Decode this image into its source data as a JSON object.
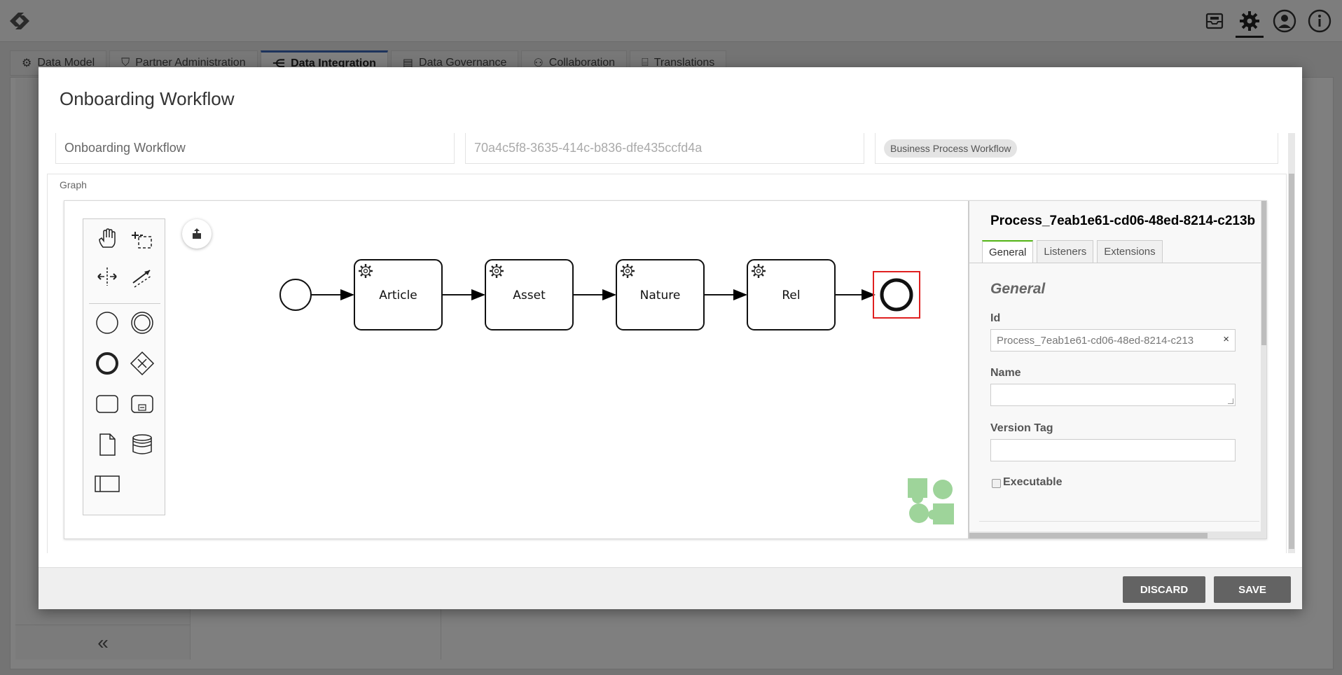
{
  "app": {
    "tabs": [
      {
        "label": "Data Model",
        "icon": "data-model-icon"
      },
      {
        "label": "Partner Administration",
        "icon": "shield-icon"
      },
      {
        "label": "Data Integration",
        "icon": "share-icon"
      },
      {
        "label": "Data Governance",
        "icon": "document-icon"
      },
      {
        "label": "Collaboration",
        "icon": "people-icon"
      },
      {
        "label": "Translations",
        "icon": "translate-icon"
      }
    ],
    "collapse_symbol": "«"
  },
  "modal": {
    "title": "Onboarding Workflow",
    "fields": {
      "name_value": "Onboarding Workflow",
      "id_value": "70a4c5f8-3635-414c-b836-dfe435ccfd4a",
      "type_chip": "Business Process Workflow"
    },
    "graph_label": "Graph",
    "diagram": {
      "tasks": [
        "Article",
        "Asset",
        "Nature",
        "Rel"
      ]
    },
    "properties": {
      "title": "Process_7eab1e61-cd06-48ed-8214-c213b",
      "tabs": [
        "General",
        "Listeners",
        "Extensions"
      ],
      "active_tab": "General",
      "section_title": "General",
      "id_label": "Id",
      "id_value": "Process_7eab1e61-cd06-48ed-8214-c213",
      "clear_symbol": "×",
      "name_label": "Name",
      "name_value": "",
      "version_label": "Version Tag",
      "version_value": "",
      "executable_label": "Executable"
    },
    "buttons": {
      "discard": "DISCARD",
      "save": "SAVE"
    }
  },
  "colors": {
    "accent_tab": "#3a66b8",
    "active_props_tab": "#52b415",
    "selection": "#e02020",
    "button": "#636363",
    "bpmn_logo": "#9ed49a"
  }
}
